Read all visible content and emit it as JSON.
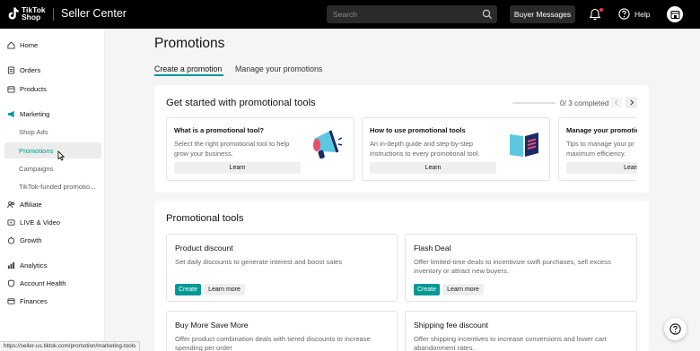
{
  "topbar": {
    "logo_text_line1": "TikTok",
    "logo_text_line2": "Shop",
    "brand": "Seller Center",
    "search_placeholder": "Search",
    "buyer_messages": "Buyer Messages",
    "help": "Help"
  },
  "sidebar": {
    "items": [
      {
        "label": "Home",
        "icon": "home-icon"
      },
      {
        "label": "Orders",
        "icon": "orders-icon"
      },
      {
        "label": "Products",
        "icon": "products-icon"
      },
      {
        "label": "Marketing",
        "icon": "marketing-icon"
      },
      {
        "label": "Shop Ads"
      },
      {
        "label": "Promotions"
      },
      {
        "label": "Campaigns"
      },
      {
        "label": "TikTok-funded promotio..."
      },
      {
        "label": "Affiliate",
        "icon": "affiliate-icon"
      },
      {
        "label": "LIVE & Video",
        "icon": "live-video-icon"
      },
      {
        "label": "Growth",
        "icon": "growth-icon"
      },
      {
        "label": "Analytics",
        "icon": "analytics-icon"
      },
      {
        "label": "Account Health",
        "icon": "account-health-icon"
      },
      {
        "label": "Finances",
        "icon": "finances-icon"
      }
    ],
    "active_item": "Promotions"
  },
  "status_url": "https://seller-us.tiktok.com/promotion/marketing-tools",
  "main": {
    "title": "Promotions",
    "tabs": [
      {
        "label": "Create a promotion",
        "active": true
      },
      {
        "label": "Manage your promotions",
        "active": false
      }
    ],
    "get_started": {
      "title": "Get started with promotional tools",
      "progress_text": "0/ 3 completed",
      "progress_fraction": 0,
      "cards": [
        {
          "title": "What is a promotional tool?",
          "desc": "Select the right promotional tool to help grow your business.",
          "button": "Learn",
          "illustration": "megaphone-illustration"
        },
        {
          "title": "How to use promotional tools",
          "desc": "An in-depth guide and step-by-step instructions to every promotional tool.",
          "button": "Learn",
          "illustration": "book-illustration"
        },
        {
          "title": "Manage your promotio",
          "desc": "Tips to manage your pr maximum efficiency.",
          "button": "Learn"
        }
      ]
    },
    "tools": {
      "title": "Promotional tools",
      "items": [
        {
          "title": "Product discount",
          "desc": "Set daily discounts to generate interest and boost sales",
          "create": "Create",
          "learn_more": "Learn more"
        },
        {
          "title": "Flash Deal",
          "desc": "Offer limited-time deals to incentivize swift purchases, sell excess inventory or attract new buyers.",
          "create": "Create",
          "learn_more": "Learn more"
        },
        {
          "title": "Buy More Save More",
          "desc": "Offer product combination deals with tiered discounts to increase spending per order"
        },
        {
          "title": "Shipping fee discount",
          "desc": "Offer shipping incentives to increase conversions and lower cart abandonment rates."
        }
      ]
    }
  },
  "colors": {
    "accent": "#009995",
    "topbar": "#000000",
    "notification": "#fe2c55"
  }
}
